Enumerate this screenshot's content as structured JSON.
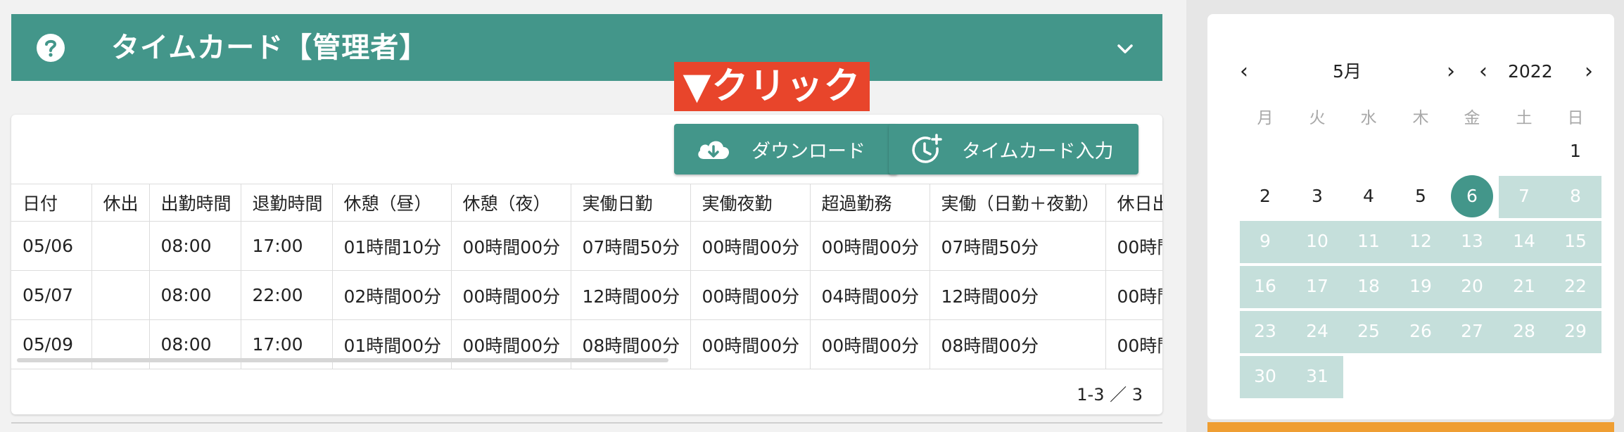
{
  "header": {
    "title": "タイムカード【管理者】"
  },
  "annotation": {
    "text": "▼クリック"
  },
  "toolbar": {
    "download_label": "ダウンロード",
    "timecard_label": "タイムカード入力"
  },
  "table": {
    "columns": [
      "日付",
      "休出",
      "出勤時間",
      "退勤時間",
      "休憩（昼）",
      "休憩（夜）",
      "実働日勤",
      "実働夜勤",
      "超過勤務",
      "実働（日勤＋夜勤）",
      "休日出"
    ],
    "rows": [
      [
        "05/06",
        "",
        "08:00",
        "17:00",
        "01時間10分",
        "00時間00分",
        "07時間50分",
        "00時間00分",
        "00時間00分",
        "07時間50分",
        "00時間"
      ],
      [
        "05/07",
        "",
        "08:00",
        "22:00",
        "02時間00分",
        "00時間00分",
        "12時間00分",
        "00時間00分",
        "04時間00分",
        "12時間00分",
        "00時間"
      ],
      [
        "05/09",
        "",
        "08:00",
        "17:00",
        "01時間00分",
        "00時間00分",
        "08時間00分",
        "00時間00分",
        "00時間00分",
        "08時間00分",
        "00時間"
      ]
    ]
  },
  "pagination": {
    "text": "1-3 ／ 3"
  },
  "calendar": {
    "month_label": "5月",
    "year_label": "2022",
    "weekdays": [
      "月",
      "火",
      "水",
      "木",
      "金",
      "土",
      "日"
    ],
    "days": [
      "1",
      "2",
      "3",
      "4",
      "5",
      "6",
      "7",
      "8",
      "9",
      "10",
      "11",
      "12",
      "13",
      "14",
      "15",
      "16",
      "17",
      "18",
      "19",
      "20",
      "21",
      "22",
      "23",
      "24",
      "25",
      "26",
      "27",
      "28",
      "29",
      "30",
      "31"
    ],
    "selected_day": "6",
    "accent_color": "#43968a",
    "range_color": "#c5dfdb"
  },
  "colors": {
    "header_bg": "#43968a",
    "annotation_bg": "#e8452b",
    "button_bg": "#43968a"
  }
}
